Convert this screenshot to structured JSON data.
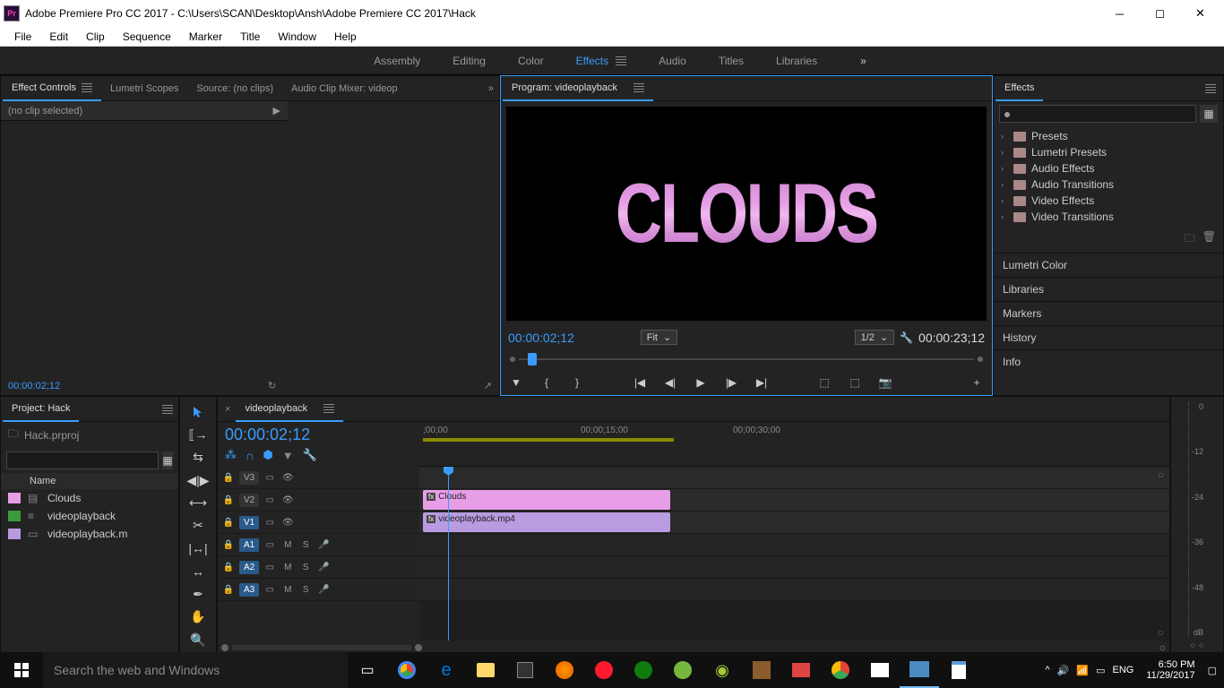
{
  "title": "Adobe Premiere Pro CC 2017 - C:\\Users\\SCAN\\Desktop\\Ansh\\Adobe Premiere CC 2017\\Hack",
  "appicon": "Pr",
  "menu": [
    "File",
    "Edit",
    "Clip",
    "Sequence",
    "Marker",
    "Title",
    "Window",
    "Help"
  ],
  "workspaces": [
    "Assembly",
    "Editing",
    "Color",
    "Effects",
    "Audio",
    "Titles",
    "Libraries"
  ],
  "workspace_active": "Effects",
  "effectControls": {
    "tabs": [
      "Effect Controls",
      "Lumetri Scopes",
      "Source: (no clips)",
      "Audio Clip Mixer: videop"
    ],
    "noclip": "(no clip selected)",
    "timecode": "00:00:02;12"
  },
  "program": {
    "title": "Program: videoplayback",
    "text": "CLOUDS",
    "tc_current": "00:00:02;12",
    "tc_total": "00:00:23;12",
    "fit": "Fit",
    "scale": "1/2"
  },
  "effects": {
    "title": "Effects",
    "folders": [
      "Presets",
      "Lumetri Presets",
      "Audio Effects",
      "Audio Transitions",
      "Video Effects",
      "Video Transitions"
    ],
    "sections": [
      "Lumetri Color",
      "Libraries",
      "Markers",
      "History",
      "Info"
    ]
  },
  "project": {
    "title": "Project: Hack",
    "file": "Hack.prproj",
    "colName": "Name",
    "items": [
      {
        "color": "#e79ee7",
        "name": "Clouds",
        "type": "title"
      },
      {
        "color": "#3a9b3a",
        "name": "videoplayback",
        "type": "seq"
      },
      {
        "color": "#b89be0",
        "name": "videoplayback.m",
        "type": "clip"
      }
    ]
  },
  "timeline": {
    "seqname": "videoplayback",
    "tc": "00:00:02;12",
    "ruler": [
      ";00;00",
      "00;00;15;00",
      "00;00;30;00"
    ],
    "tracks_v": [
      "V3",
      "V2",
      "V1"
    ],
    "tracks_a": [
      "A1",
      "A2",
      "A3"
    ],
    "clip_v2": "Clouds",
    "clip_v1": "videoplayback.mp4"
  },
  "meter": {
    "labels": [
      "0",
      "-12",
      "-24",
      "-36",
      "-48",
      "dB"
    ]
  },
  "taskbar": {
    "search": "Search the web and Windows",
    "lang": "ENG",
    "time": "6:50 PM",
    "date": "11/29/2017"
  }
}
